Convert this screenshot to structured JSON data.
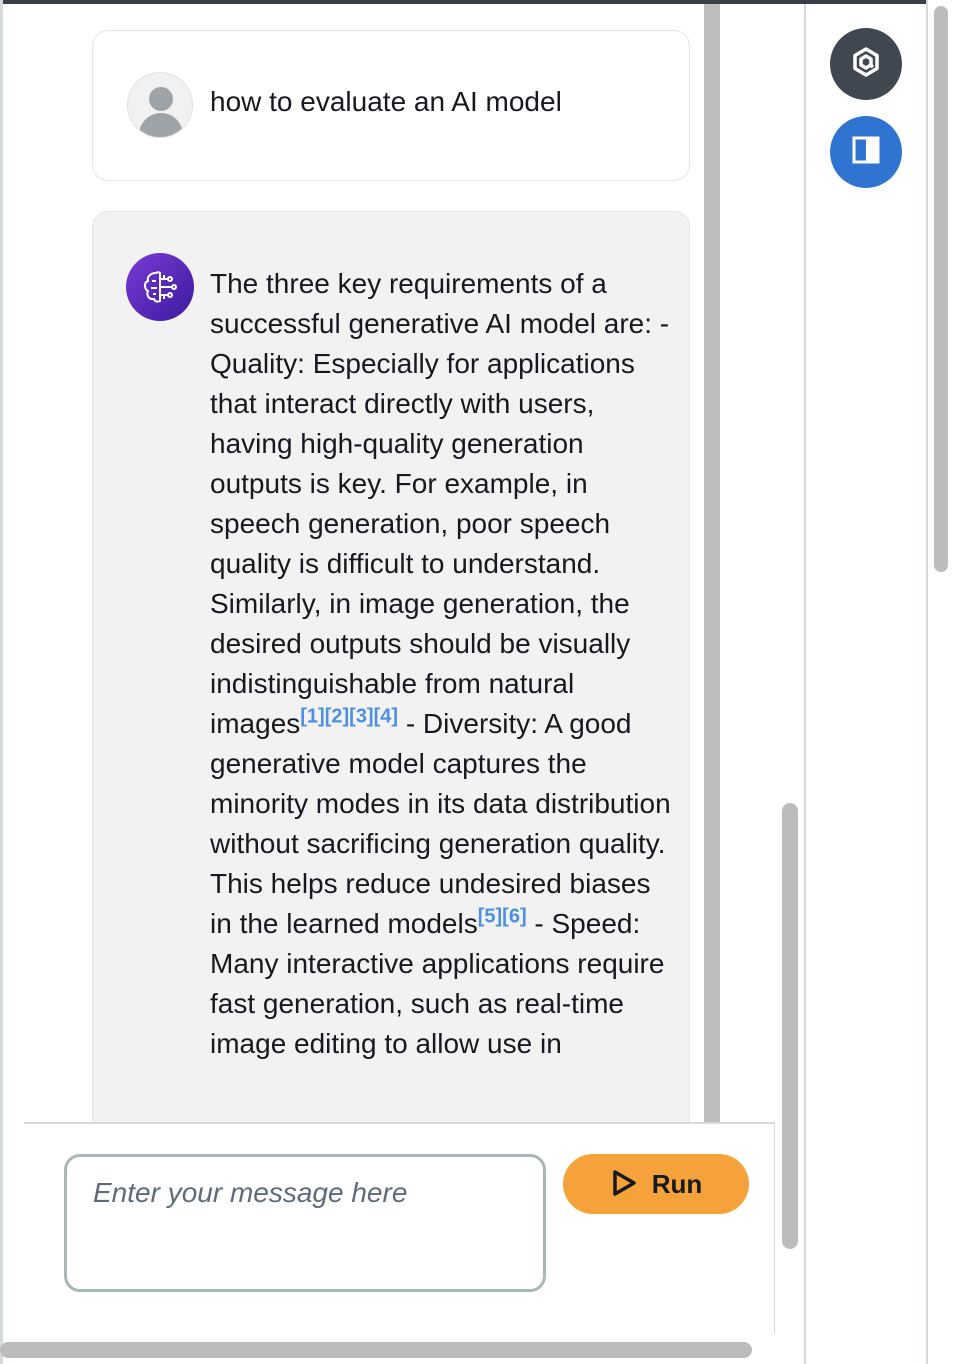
{
  "conversation": {
    "user_message": "how to evaluate an AI model",
    "ai_response": {
      "part1": "The three key requirements of a successful generative AI model are: - Quality: Especially for applications that interact directly with users, having high-quality generation outputs is key. For example, in speech generation, poor speech quality is difficult to understand. Similarly, in image generation, the desired outputs should be visually indistinguishable from natural images",
      "cite1": "[1][2][3][4]",
      "part2": " - Diversity: A good generative model captures the minority modes in its data distribution without sacrificing generation quality. This helps reduce undesired biases in the learned models",
      "cite2": "[5][6]",
      "part3": " - Speed: Many interactive applications require fast generation, such as real-time image editing to allow use in"
    }
  },
  "input": {
    "placeholder": "Enter your message here"
  },
  "run_button": {
    "label": "Run",
    "color": "#f5a23a"
  },
  "icons": {
    "user_avatar": "user-avatar-icon",
    "ai_avatar": "ai-brain-icon",
    "run": "play-icon",
    "rail_top": "hexagon-logo-icon",
    "rail_panel": "side-panel-icon"
  }
}
